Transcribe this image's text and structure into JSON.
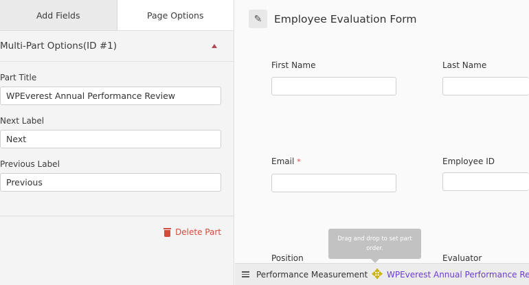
{
  "tabs": {
    "add_fields": "Add Fields",
    "page_options": "Page Options"
  },
  "options": {
    "section_title": "Multi-Part Options(ID #1)",
    "part_title_label": "Part Title",
    "part_title_value": "WPEverest Annual Performance Review",
    "next_label_label": "Next Label",
    "next_label_value": "Next",
    "previous_label_label": "Previous Label",
    "previous_label_value": "Previous",
    "delete_label": "Delete Part"
  },
  "form": {
    "title": "Employee Evaluation Form",
    "fields": {
      "first_name": "First Name",
      "last_name": "Last Name",
      "email": "Email",
      "email_required": "*",
      "employee_id": "Employee ID",
      "position": "Position",
      "evaluator": "Evaluator"
    }
  },
  "tooltip": {
    "text": "Drag and drop to set part order."
  },
  "parts_bar": {
    "part1": "Performance Measurement",
    "part2": "WPEverest Annual Performance Review"
  },
  "colors": {
    "accent_purple": "#6b3bd1",
    "delete_red": "#d54b3b",
    "required_red": "#e04b4b"
  },
  "icons": [
    "pencil-icon",
    "caret-up-icon",
    "trash-icon",
    "hamburger-icon",
    "move-icon"
  ]
}
